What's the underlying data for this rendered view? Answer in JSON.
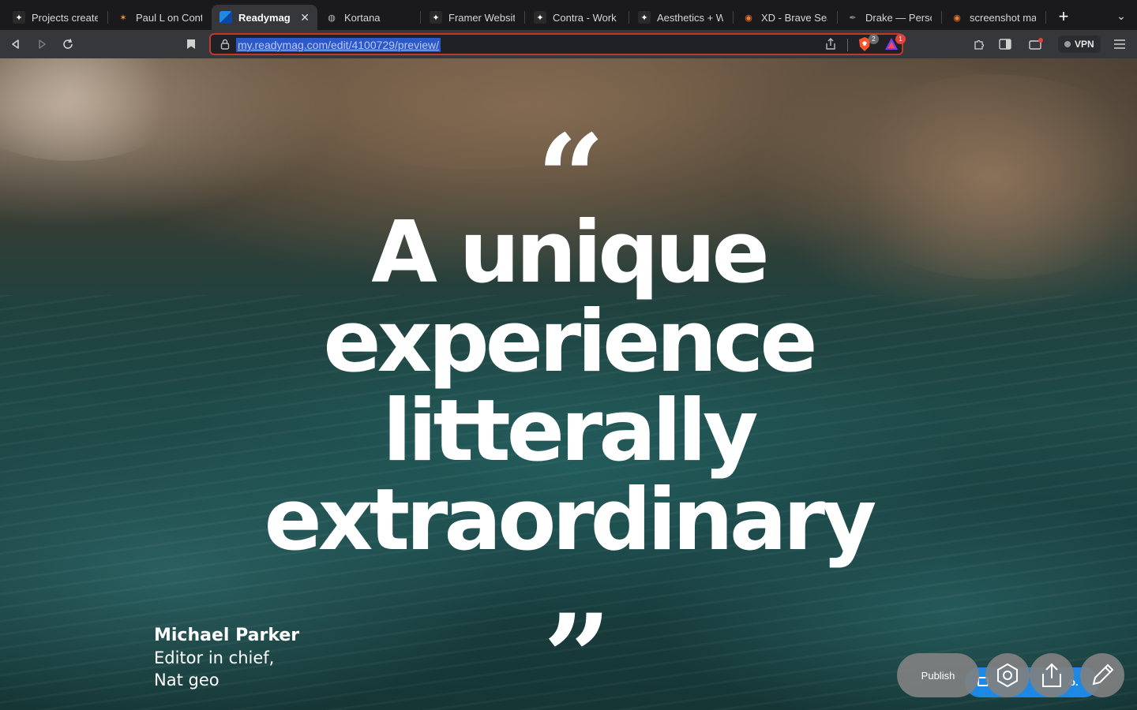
{
  "browser": {
    "tabs": [
      {
        "title": "Projects created",
        "icon": "contra-icon",
        "active": false
      },
      {
        "title": "Paul L on Contra",
        "icon": "contra-star-icon",
        "active": false
      },
      {
        "title": "Readymag • l",
        "icon": "readymag-icon",
        "active": true
      },
      {
        "title": "Kortana",
        "icon": "globe-icon",
        "active": false
      },
      {
        "title": "Framer Website",
        "icon": "framer-icon",
        "active": false
      },
      {
        "title": "Contra - Work th",
        "icon": "contra-icon",
        "active": false
      },
      {
        "title": "Aesthetics + We",
        "icon": "contra-icon",
        "active": false
      },
      {
        "title": "XD - Brave Searc",
        "icon": "brave-search-icon",
        "active": false
      },
      {
        "title": "Drake — Person",
        "icon": "drake-icon",
        "active": false
      },
      {
        "title": "screenshot mac",
        "icon": "brave-search-icon",
        "active": false
      }
    ],
    "url": "my.readymag.com/edit/4100729/preview/",
    "shield_count": "2",
    "rewards_count": "1",
    "vpn_label": "VPN",
    "accent_color": "#c0392b"
  },
  "page": {
    "quote_open": "“",
    "quote_close": "”",
    "headline_lines": [
      "A unique",
      "experience",
      "litterally",
      "extraordinary"
    ],
    "author": {
      "name": "Michael Parker",
      "role": "Editor in chief,",
      "org": "Nat geo"
    }
  },
  "editor": {
    "publish_label": "Publish",
    "blue_pill_text": "o.",
    "blue_color": "#1e88e5"
  }
}
